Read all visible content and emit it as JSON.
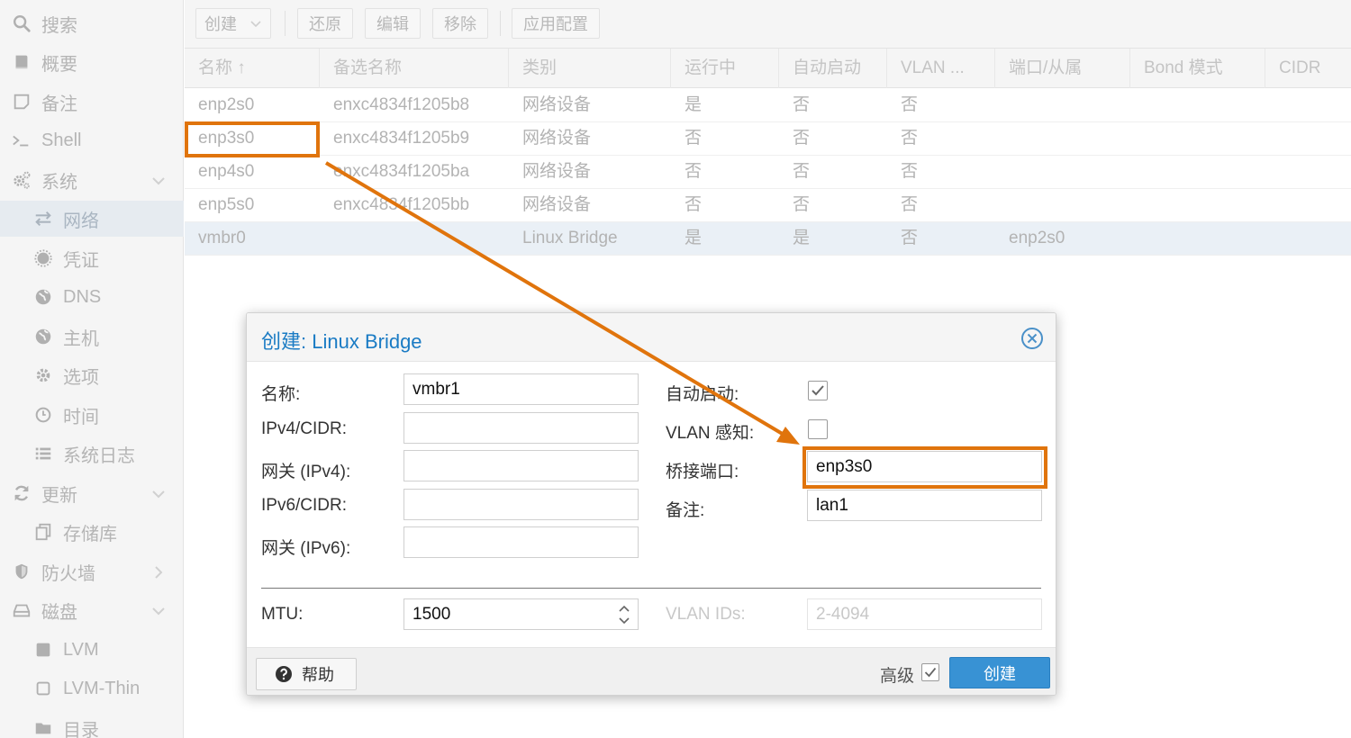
{
  "sidebar": {
    "items": [
      {
        "label": "搜索",
        "icon": "search-icon"
      },
      {
        "label": "概要",
        "icon": "book-icon"
      },
      {
        "label": "备注",
        "icon": "note-icon"
      },
      {
        "label": "Shell",
        "icon": "terminal-icon"
      },
      {
        "label": "系统",
        "icon": "cogs-icon"
      },
      {
        "label": "网络",
        "icon": "exchange-icon"
      },
      {
        "label": "凭证",
        "icon": "certificate-icon"
      },
      {
        "label": "DNS",
        "icon": "globe-icon"
      },
      {
        "label": "主机",
        "icon": "globe-icon"
      },
      {
        "label": "选项",
        "icon": "gear-icon"
      },
      {
        "label": "时间",
        "icon": "clock-icon"
      },
      {
        "label": "系统日志",
        "icon": "list-icon"
      },
      {
        "label": "更新",
        "icon": "refresh-icon"
      },
      {
        "label": "存储库",
        "icon": "copy-icon"
      },
      {
        "label": "防火墙",
        "icon": "shield-icon"
      },
      {
        "label": "磁盘",
        "icon": "hdd-icon"
      },
      {
        "label": "LVM",
        "icon": "square-icon"
      },
      {
        "label": "LVM-Thin",
        "icon": "square-outline-icon"
      },
      {
        "label": "目录",
        "icon": "folder-icon"
      }
    ]
  },
  "toolbar": {
    "create": "创建",
    "revert": "还原",
    "edit": "编辑",
    "remove": "移除",
    "apply": "应用配置"
  },
  "grid": {
    "columns": [
      "名称 ↑",
      "备选名称",
      "类别",
      "运行中",
      "自动启动",
      "VLAN ...",
      "端口/从属",
      "Bond 模式",
      "CIDR"
    ],
    "rows": [
      {
        "name": "enp2s0",
        "altname": "enxc4834f1205b8",
        "type": "网络设备",
        "active": "是",
        "autostart": "否",
        "vlan": "否",
        "ports": ""
      },
      {
        "name": "enp3s0",
        "altname": "enxc4834f1205b9",
        "type": "网络设备",
        "active": "否",
        "autostart": "否",
        "vlan": "否",
        "ports": ""
      },
      {
        "name": "enp4s0",
        "altname": "enxc4834f1205ba",
        "type": "网络设备",
        "active": "否",
        "autostart": "否",
        "vlan": "否",
        "ports": ""
      },
      {
        "name": "enp5s0",
        "altname": "enxc4834f1205bb",
        "type": "网络设备",
        "active": "否",
        "autostart": "否",
        "vlan": "否",
        "ports": ""
      },
      {
        "name": "vmbr0",
        "altname": "",
        "type": "Linux Bridge",
        "active": "是",
        "autostart": "是",
        "vlan": "否",
        "ports": "enp2s0"
      }
    ]
  },
  "dialog": {
    "title_prefix": "创建: ",
    "title_main": "Linux Bridge",
    "labels": {
      "name": "名称:",
      "ipv4": "IPv4/CIDR:",
      "gw4": "网关 (IPv4):",
      "ipv6": "IPv6/CIDR:",
      "gw6": "网关 (IPv6):",
      "autostart": "自动启动:",
      "vlan_aware": "VLAN 感知:",
      "bridge_ports": "桥接端口:",
      "comment": "备注:",
      "mtu": "MTU:",
      "vlan_ids": "VLAN IDs:"
    },
    "values": {
      "name": "vmbr1",
      "ipv4": "",
      "gw4": "",
      "ipv6": "",
      "gw6": "",
      "autostart": true,
      "vlan_aware": false,
      "bridge_ports": "enp3s0",
      "comment": "lan1",
      "mtu": "1500",
      "vlan_ids_placeholder": "2-4094"
    },
    "footer": {
      "help": "帮助",
      "advanced": "高级",
      "advanced_checked": true,
      "create": "创建"
    }
  },
  "colors": {
    "accent": "#3892d4",
    "title_blue": "#1a7bc4",
    "annotation": "#e0740c"
  }
}
